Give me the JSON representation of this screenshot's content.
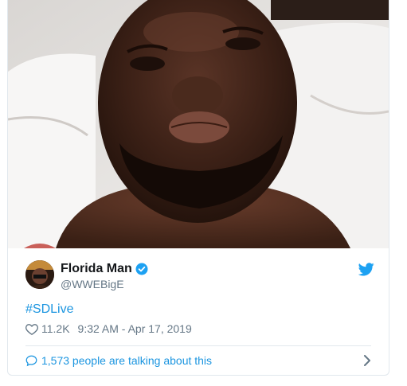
{
  "author": {
    "display_name": "Florida Man",
    "handle": "@WWEBigE",
    "verified": true,
    "avatar_icon": "avatar-photo"
  },
  "tweet": {
    "text": "#SDLive",
    "likes": "11.2K",
    "timestamp": "9:32 AM - Apr 17, 2019"
  },
  "footer": {
    "talking_text": "1,573 people are talking about this"
  },
  "icons": {
    "bird": "twitter-bird-icon",
    "verified": "verified-badge-icon",
    "heart": "heart-icon",
    "bubble": "speech-bubble-icon",
    "chevron": "chevron-right-icon"
  },
  "colors": {
    "link": "#1b95e0",
    "muted": "#657786",
    "text": "#14171a",
    "border": "#e1e8ed"
  }
}
